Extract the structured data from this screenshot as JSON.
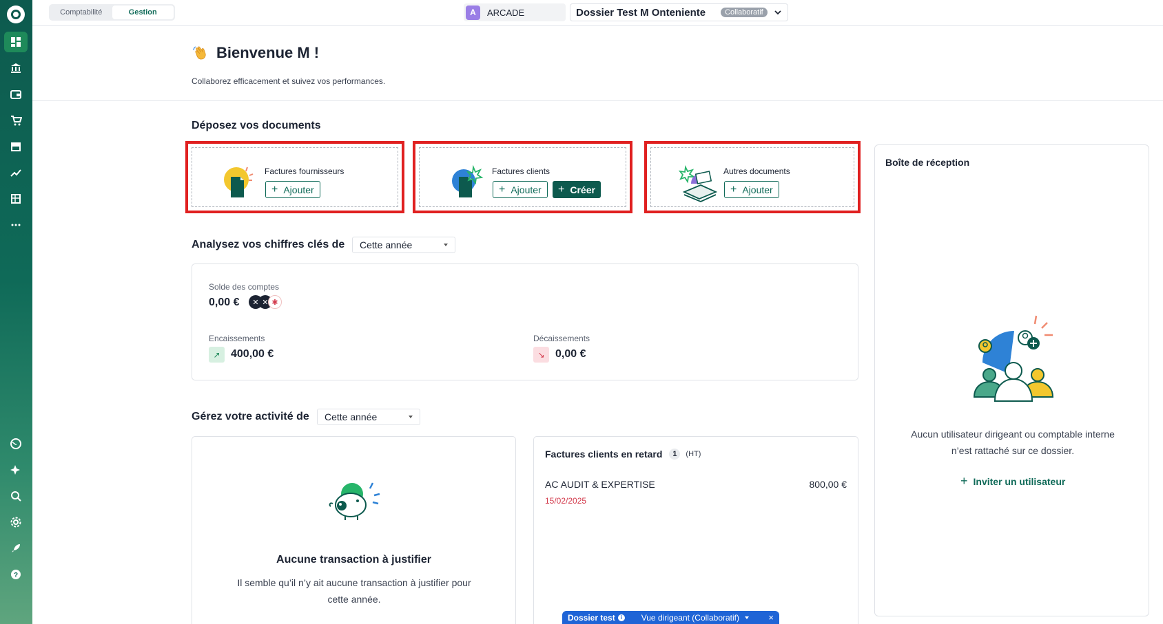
{
  "topbar": {
    "modes": [
      "Comptabilité",
      "Gestion"
    ],
    "active_mode": "Gestion",
    "org_initial": "A",
    "org_name": "ARCADE",
    "folder_name": "Dossier Test M Onteniente",
    "folder_badge": "Collaboratif"
  },
  "sidebar": {
    "items": [
      {
        "icon": "dashboard-icon",
        "active": true
      },
      {
        "icon": "bank-icon"
      },
      {
        "icon": "wallet-icon"
      },
      {
        "icon": "cart-icon"
      },
      {
        "icon": "store-icon"
      },
      {
        "icon": "trend-chart-icon"
      },
      {
        "icon": "spreadsheet-icon"
      },
      {
        "icon": "more-icon"
      }
    ],
    "bottom_items": [
      {
        "icon": "globe-icon"
      },
      {
        "icon": "sparkles-icon"
      },
      {
        "icon": "search-icon"
      },
      {
        "icon": "settings-icon"
      },
      {
        "icon": "rocket-icon"
      },
      {
        "icon": "help-icon"
      }
    ]
  },
  "header": {
    "title": "Bienvenue M !",
    "subtitle": "Collaborez efficacement et suivez vos performances."
  },
  "deposit": {
    "title": "Déposez vos documents",
    "cards": [
      {
        "label": "Factures fournisseurs",
        "add_label": "Ajouter"
      },
      {
        "label": "Factures clients",
        "add_label": "Ajouter",
        "create_label": "Créer"
      },
      {
        "label": "Autres documents",
        "add_label": "Ajouter"
      }
    ]
  },
  "analysis": {
    "title": "Analysez vos chiffres clés de",
    "period": "Cette année",
    "balance_label": "Solde des comptes",
    "balance_value": "0,00 €",
    "inflows_label": "Encaissements",
    "inflows_value": "400,00 €",
    "outflows_label": "Décaissements",
    "outflows_value": "0,00 €"
  },
  "activity": {
    "title": "Gérez votre activité de",
    "period": "Cette année",
    "tx_title": "Aucune transaction à justifier",
    "tx_desc": "Il semble qu’il n’y ait aucune transaction à justifier pour cette année.",
    "late_title": "Factures clients en retard",
    "late_count": "1",
    "late_unit": "(HT)",
    "late_items": [
      {
        "client": "AC AUDIT & EXPERTISE",
        "amount": "800,00 €",
        "date": "15/02/2025"
      }
    ]
  },
  "inbox": {
    "title": "Boîte de réception",
    "message": "Aucun utilisateur dirigeant ou comptable interne n’est rattaché sur ce dossier.",
    "invite_label": "Inviter un utilisateur"
  },
  "float_bar": {
    "name": "Dossier test",
    "view": "Vue dirigeant (Collaboratif)",
    "close": "×"
  },
  "colors": {
    "brand": "#0d5a4e",
    "highlight": "#e02020",
    "late_date": "#d33b4d",
    "float_bar": "#1f64d6"
  }
}
